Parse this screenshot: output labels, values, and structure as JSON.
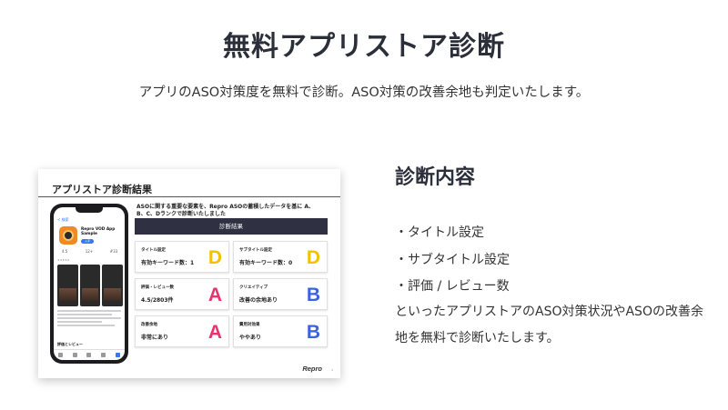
{
  "page": {
    "title": "無料アプリストア診断",
    "subtitle": "アプリのASO対策度を無料で診断。ASO対策の改善余地も判定いたします。"
  },
  "report": {
    "title": "アプリストア診断結果",
    "phone": {
      "back": "< 検索",
      "app_name": "Repro VOD App Sample",
      "get_label": "入手",
      "stats": [
        "4.5",
        "12+",
        "#33"
      ],
      "stars": "★★★★★",
      "reviews_label": "評価とレビュー"
    },
    "description": "ASOに関する重要な要素を、Repro ASOの蓄積したデータを基に A、B、C、Dランクで診断いたしました",
    "result_label": "診断結果",
    "cards": [
      {
        "label": "タイトル設定",
        "value": "有効キーワード数：1",
        "grade": "D",
        "color": "#f2c200"
      },
      {
        "label": "サブタイトル設定",
        "value": "有効キーワード数：0",
        "grade": "D",
        "color": "#f2c200"
      },
      {
        "label": "評価・レビュー数",
        "value": "4.5/2803件",
        "grade": "A",
        "color": "#e8336d"
      },
      {
        "label": "クリエイティブ",
        "value": "改善の余地あり",
        "grade": "B",
        "color": "#3a63e0"
      },
      {
        "label": "改善余地",
        "value": "非常にあり",
        "grade": "A",
        "color": "#e8336d"
      },
      {
        "label": "費用対効果",
        "value": "ややあり",
        "grade": "B",
        "color": "#3a63e0"
      }
    ],
    "brand": "Repro",
    "page_no": "1"
  },
  "details": {
    "heading": "診断内容",
    "items": [
      "・タイトル設定",
      "・サブタイトル設定",
      "・評価 / レビュー数"
    ],
    "body": "といったアプリストアのASO対策状況やASOの改善余地を無料で診断いたします。"
  }
}
